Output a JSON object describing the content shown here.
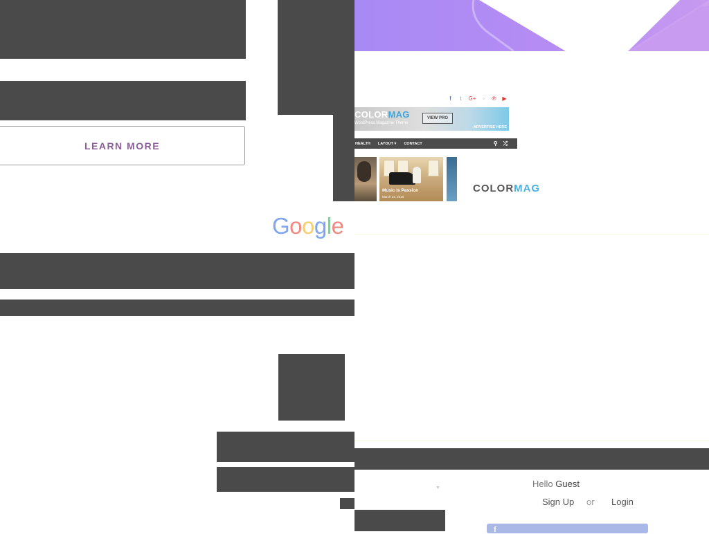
{
  "left_panel": {
    "learn_more_label": "LEARN MORE",
    "learn_more_color": "#8b5e99"
  },
  "google_logo": {
    "letters": [
      "G",
      "o",
      "o",
      "g",
      "l",
      "e"
    ],
    "colors": [
      "#7fa6ef",
      "#ef8a83",
      "#f6cf6d",
      "#7fa6ef",
      "#84c99b",
      "#ef8a83"
    ]
  },
  "header": {
    "gradient_colors": [
      "#a88af5",
      "#c79af0"
    ]
  },
  "colormag_preview": {
    "social_icons": [
      "facebook-icon",
      "twitter-icon",
      "google-plus-icon",
      "instagram-icon",
      "pinterest-icon",
      "youtube-icon"
    ],
    "social_glyphs": [
      "f",
      "t",
      "G+",
      "◦",
      "℗",
      "▶"
    ],
    "banner_title_part1": "COLOR",
    "banner_title_part2": "MAG",
    "banner_subtitle": "WordPress Magazine Theme",
    "view_pro_label": "VIEW PRO",
    "advertise_label": "ADVERTISE HERE",
    "nav_items": [
      "HEALTH",
      "LAYOUT ▾",
      "CONTACT"
    ],
    "nav_icons": [
      "search-icon",
      "shuffle-icon"
    ],
    "thumb_caption": "Music Is Passion",
    "thumb_date": "March 24, 2015",
    "logo_part1": "COLOR",
    "logo_part2": "MAG"
  },
  "account": {
    "hello_prefix": "Hello",
    "guest_name": "Guest",
    "signup_label": "Sign Up",
    "or_label": "or",
    "login_label": "Login",
    "facebook_glyph": "f"
  }
}
